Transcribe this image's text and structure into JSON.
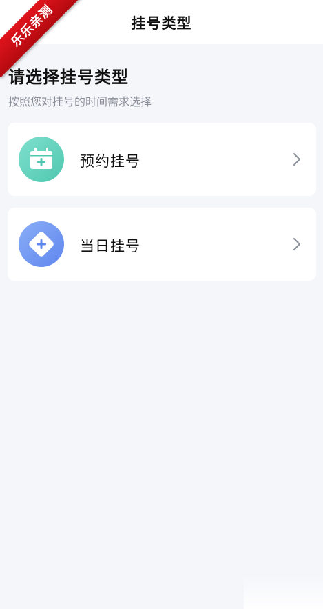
{
  "watermark": {
    "text": "乐乐亲测"
  },
  "header": {
    "title": "挂号类型"
  },
  "intro": {
    "title": "请选择挂号类型",
    "subtitle": "按照您对挂号的时间需求选择"
  },
  "options": [
    {
      "label": "预约挂号",
      "icon": "calendar-plus-icon",
      "color": "#5fd0bb"
    },
    {
      "label": "当日挂号",
      "icon": "diamond-plus-icon",
      "color": "#6f94f1"
    }
  ],
  "colors": {
    "background": "#f5f6fa",
    "card": "#ffffff",
    "title": "#111111",
    "subtitle": "#8a8f99",
    "chevron": "#8a8f99"
  }
}
